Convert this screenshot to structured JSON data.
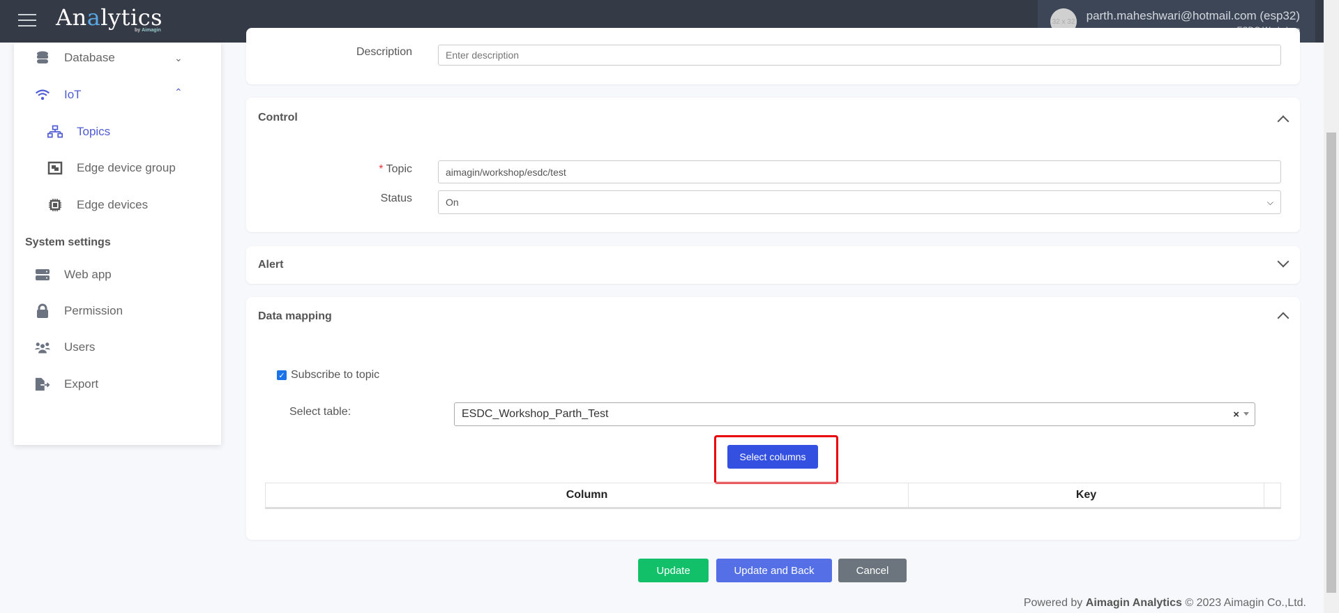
{
  "header": {
    "logo_text": "Analytics",
    "logo_sub": "by Aimagin",
    "avatar_placeholder": "32 x 32",
    "user_email": "parth.maheshwari@hotmail.com (esp32)",
    "user_org": "ESDC Workshop"
  },
  "sidebar": {
    "items": [
      {
        "label": "Database",
        "icon": "database-icon",
        "expanded": false
      },
      {
        "label": "IoT",
        "icon": "wifi-icon",
        "expanded": true,
        "active": true
      },
      {
        "label": "Topics",
        "icon": "network-icon",
        "active": true
      },
      {
        "label": "Edge device group",
        "icon": "object-group-icon"
      },
      {
        "label": "Edge devices",
        "icon": "microchip-icon"
      }
    ],
    "section_title": "System settings",
    "system_items": [
      {
        "label": "Web app",
        "icon": "server-icon"
      },
      {
        "label": "Permission",
        "icon": "lock-icon"
      },
      {
        "label": "Users",
        "icon": "users-icon"
      },
      {
        "label": "Export",
        "icon": "file-export-icon"
      }
    ]
  },
  "form": {
    "description_label": "Description",
    "description_placeholder": "Enter description",
    "control": {
      "title": "Control",
      "topic_label": "Topic",
      "required_mark": "*",
      "topic_value": "aimagin/workshop/esdc/test",
      "status_label": "Status",
      "status_value": "On"
    },
    "alert": {
      "title": "Alert"
    },
    "data_mapping": {
      "title": "Data mapping",
      "subscribe_label": "Subscribe to topic",
      "subscribe_checked": true,
      "select_table_label": "Select table:",
      "select_table_value": "ESDC_Workshop_Parth_Test",
      "select_columns_label": "Select columns",
      "table_headers": [
        "Column",
        "Key"
      ]
    }
  },
  "actions": {
    "update": "Update",
    "update_back": "Update and Back",
    "cancel": "Cancel"
  },
  "footer": {
    "prefix": "Powered by",
    "brand": "Aimagin Analytics",
    "suffix": "© 2023 Aimagin Co.,Ltd."
  },
  "colors": {
    "header": "#343a46",
    "accent": "#4f5bd5",
    "primary": "#3350e0",
    "success": "#12c06a",
    "secondary": "#6c757d",
    "highlight": "#e8000b"
  }
}
